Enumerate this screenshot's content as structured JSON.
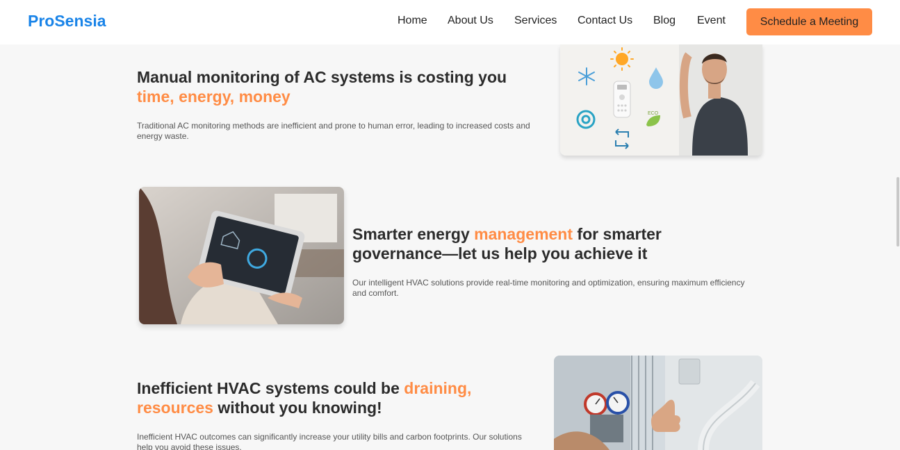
{
  "header": {
    "logo": "ProSensia",
    "nav": [
      "Home",
      "About Us",
      "Services",
      "Contact Us",
      "Blog",
      "Event"
    ],
    "cta": "Schedule a Meeting"
  },
  "section1": {
    "title_a": "Manual monitoring of AC systems is costing you",
    "title_accent": "time, energy, money",
    "desc": "Traditional AC monitoring methods are inefficient and prone to human error, leading to increased costs and energy waste.",
    "eco_label": "ECO"
  },
  "section2": {
    "title_a": "Smarter energy",
    "title_accent": "management",
    "title_b": "for smarter",
    "title_c": "governance—let us help you achieve it",
    "desc": "Our intelligent HVAC solutions provide real-time monitoring and optimization, ensuring maximum efficiency and comfort."
  },
  "section3": {
    "title_a": "Inefficient HVAC systems could be",
    "title_accent_a": "draining,",
    "title_accent_b": "resources",
    "title_b": "without you knowing!",
    "desc": "Inefficient HVAC outcomes can significantly increase your utility bills and carbon footprints. Our solutions help you avoid these issues."
  },
  "colors": {
    "brand": "#1a84e8",
    "accent": "#ff8c45"
  }
}
